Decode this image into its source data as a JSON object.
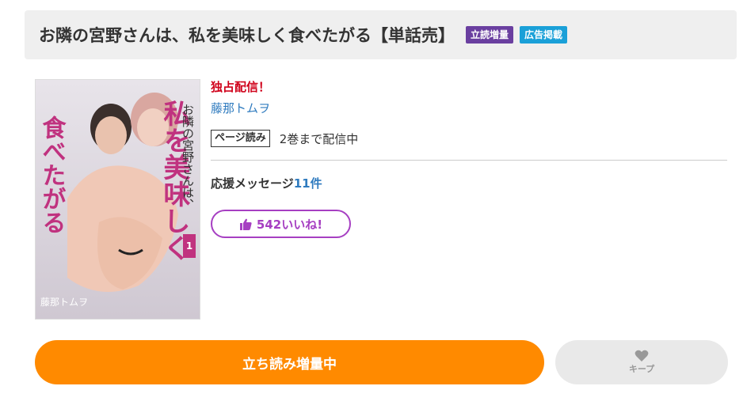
{
  "title": {
    "text": "お隣の宮野さんは、私を美味しく食べたがる【単話売】",
    "badges": [
      {
        "label": "立読増量",
        "color": "#6a3fa0"
      },
      {
        "label": "広告掲載",
        "color": "#1aa0d8"
      }
    ]
  },
  "cover": {
    "title_small": "お隣の宮野さんは、",
    "title_large_left": "食べたがる",
    "title_large_right": "私を美味しく",
    "volume": "1",
    "author_on_cover": "藤那トムヲ"
  },
  "info": {
    "exclusive": "独占配信！",
    "author": "藤那トムヲ",
    "page_tag": "ページ読み",
    "page_status": "2巻まで配信中",
    "support_label": "応援メッセージ",
    "support_count": "11件",
    "like_label": "542いいね!"
  },
  "actions": {
    "read_label": "立ち読み増量中",
    "keep_label": "キープ"
  },
  "icons": {
    "like": "thumbs-up-icon",
    "keep": "heart-icon"
  },
  "colors": {
    "accent_orange": "#ff8a00",
    "like_purple": "#a63fc2",
    "exclusive_red": "#d0021b",
    "link_blue": "#2f7bbf"
  }
}
